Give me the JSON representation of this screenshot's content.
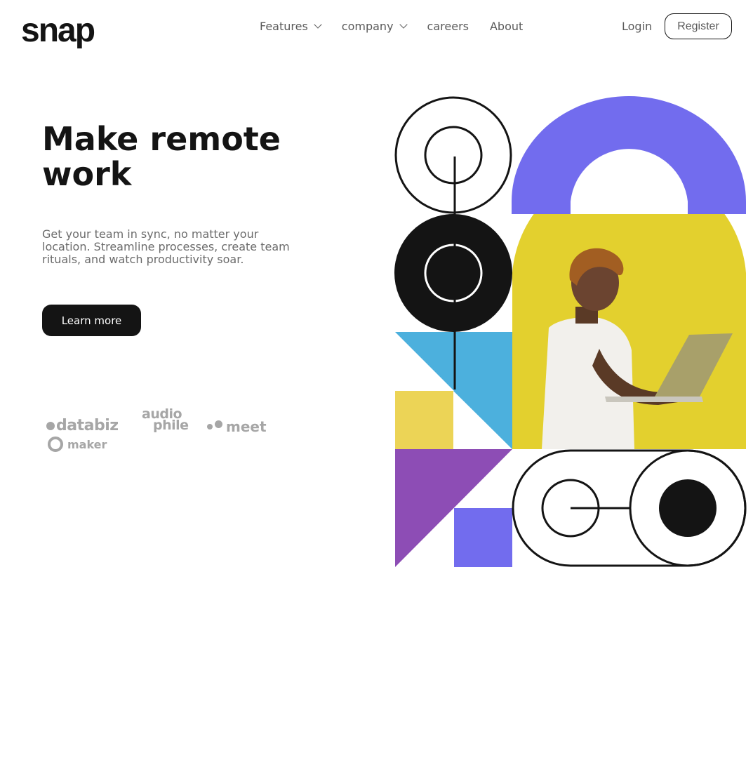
{
  "brand": {
    "logo": "snap"
  },
  "nav": {
    "items": [
      {
        "label": "Features",
        "has_dropdown": true
      },
      {
        "label": "company",
        "has_dropdown": true
      },
      {
        "label": "careers",
        "has_dropdown": false
      },
      {
        "label": "About",
        "has_dropdown": false
      }
    ],
    "login": "Login",
    "register": "Register"
  },
  "hero": {
    "title": "Make remote work",
    "text": "Get your team in sync, no matter your location. Streamline processes, create team rituals, and watch productivity soar.",
    "cta": "Learn more"
  },
  "clients": {
    "databiz": "databiz",
    "audiophile_top": "audio",
    "audiophile_bottom": "phile",
    "meet": "meet",
    "maker": "maker"
  },
  "colors": {
    "ink": "#141414",
    "muted": "#6b6b6b",
    "logo_gray": "#a6a6a6",
    "purple": "#726cee",
    "violet": "#8d4db5",
    "blue": "#4cb0dd",
    "yellow": "#ecd456",
    "photo_yellow": "#e3d02e"
  }
}
